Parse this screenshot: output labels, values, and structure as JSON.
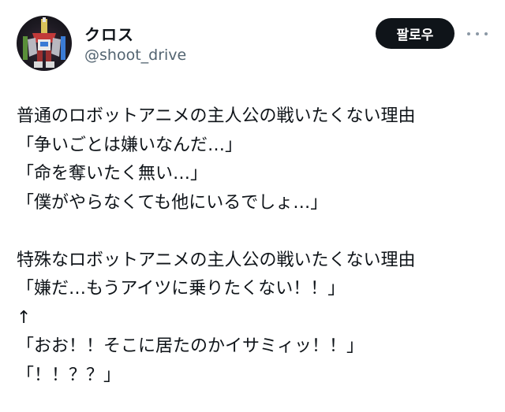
{
  "user": {
    "display_name": "クロス",
    "handle": "@shoot_drive",
    "avatar_icon": "robot-avatar-icon"
  },
  "actions": {
    "follow_label": "팔로우",
    "more_icon": "more-dots-icon"
  },
  "tweet": {
    "lines": [
      "普通のロボットアニメの主人公の戦いたくない理由",
      "「争いごとは嫌いなんだ…」",
      "「命を奪いたく無い…」",
      "「僕がやらなくても他にいるでしょ…」",
      "",
      "特殊なロボットアニメの主人公の戦いたくない理由",
      "「嫌だ…もうアイツに乗りたくない！！」",
      "↑",
      "「おお！！そこに居たのかイサミィッ！！」",
      "「！！？？」"
    ]
  },
  "colors": {
    "text": "#0f1419",
    "secondary_text": "#536471",
    "button_bg": "#0f1419",
    "button_text": "#ffffff",
    "background": "#ffffff"
  }
}
